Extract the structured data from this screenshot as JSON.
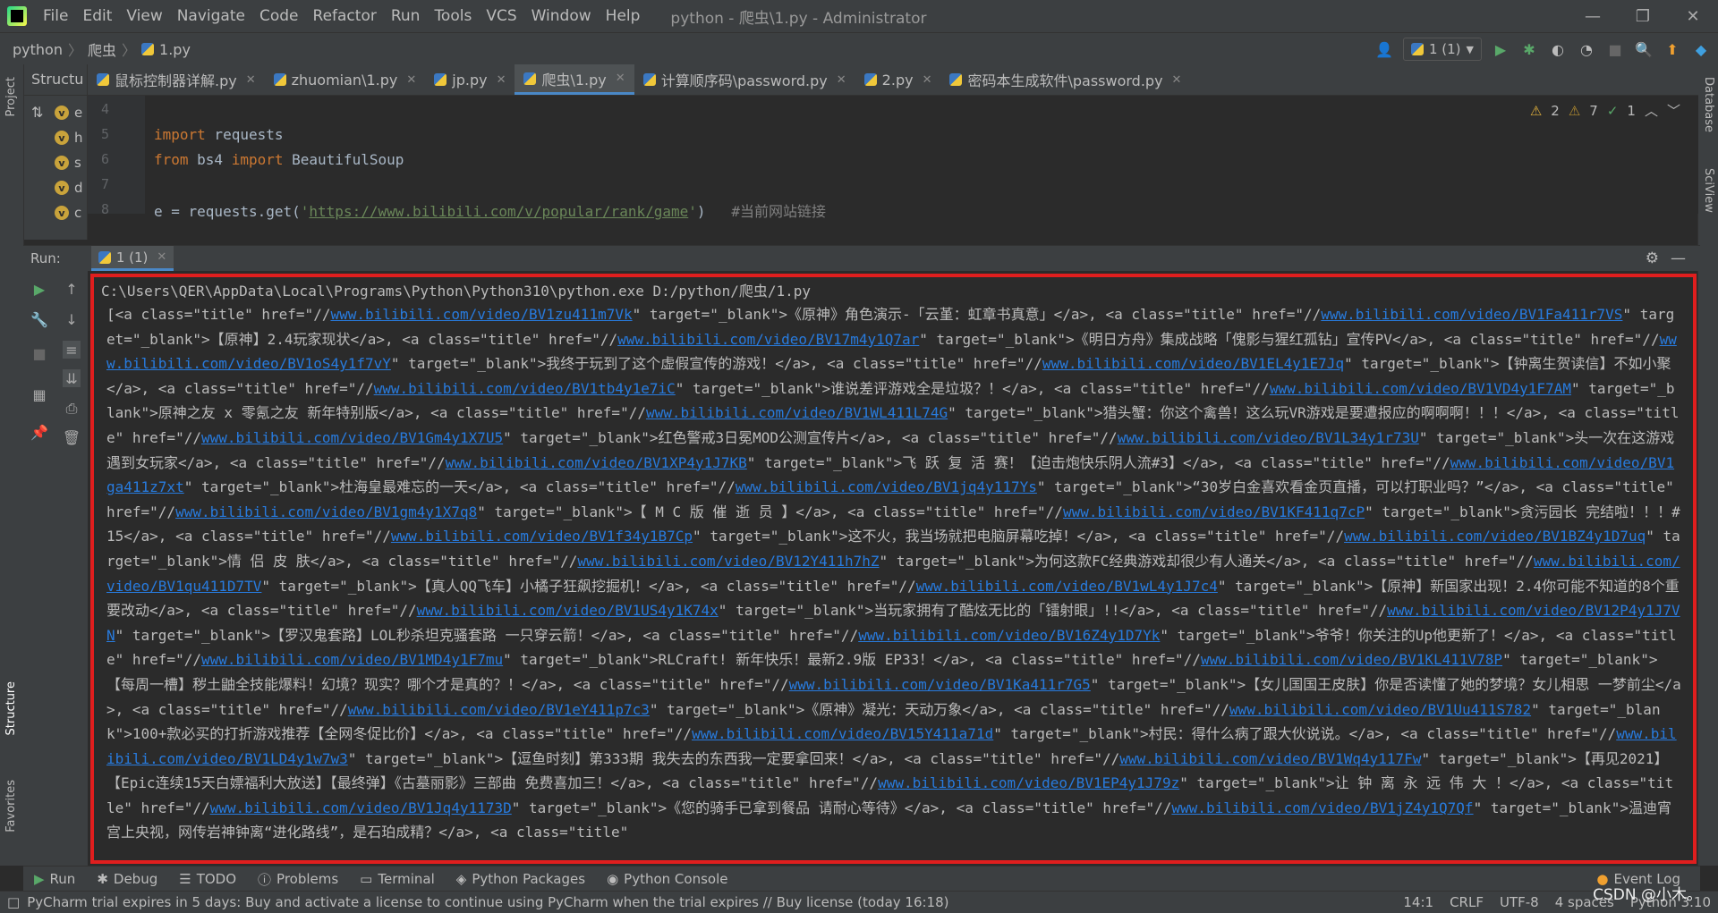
{
  "titlebar": {
    "menu": [
      "File",
      "Edit",
      "View",
      "Navigate",
      "Code",
      "Refactor",
      "Run",
      "Tools",
      "VCS",
      "Window",
      "Help"
    ],
    "title": "python - 爬虫\\1.py - Administrator"
  },
  "navbar": {
    "crumbs": [
      "python",
      "爬虫",
      "1.py"
    ],
    "run_config": "1 (1)"
  },
  "left_stripe": {
    "project": "Project",
    "structure": "Structure",
    "favorites": "Favorites"
  },
  "right_stripe": {
    "database": "Database",
    "sciview": "SciView"
  },
  "structure_panel": {
    "title": "Structu",
    "items": [
      "e",
      "h",
      "s",
      "d",
      "c"
    ]
  },
  "tabs": [
    {
      "label": "鼠标控制器详解.py"
    },
    {
      "label": "zhuomian\\1.py"
    },
    {
      "label": "jp.py"
    },
    {
      "label": "爬虫\\1.py"
    },
    {
      "label": "计算顺序码\\password.py"
    },
    {
      "label": "2.py"
    },
    {
      "label": "密码本生成软件\\password.py"
    }
  ],
  "editor": {
    "lines": [
      "4",
      "5",
      "6",
      "7",
      "8"
    ],
    "code": {
      "l5_kw": "import",
      "l5_rest": " requests",
      "l6_kw1": "from",
      "l6_mod": " bs4 ",
      "l6_kw2": "import",
      "l6_rest": " BeautifulSoup",
      "l8_pre": "e = requests.get(",
      "l8_q1": "'",
      "l8_url": "https://www.bilibili.com/v/popular/rank/game",
      "l8_q2": "'",
      "l8_post": ")   ",
      "l8_cmt": "#当前网站链接"
    },
    "inspections": {
      "warnings": "2",
      "weak": "7",
      "ok": "1"
    }
  },
  "run": {
    "label": "Run:",
    "tab": "1 (1)",
    "command": "C:\\Users\\QER\\AppData\\Local\\Programs\\Python\\Python310\\python.exe D:/python/爬虫/1.py",
    "items": [
      {
        "pre": "[<a class=\"title\" href=\"//",
        "url": "www.bilibili.com/video/BV1zu411m7Vk",
        "post": "\" target=\"_blank\">《原神》角色演示-「云堇：虹章书真意」</a>, "
      },
      {
        "pre": "<a class=\"title\" href=\"//",
        "url": "www.bilibili.com/video/BV1Fa411r7VS",
        "post": "\" target=\"_blank\">【原神】2.4玩家现状</a>, "
      },
      {
        "pre": "<a class=\"title\" href=\"//",
        "url": "www.bilibili.com/video/BV17m4y1Q7ar",
        "post": "\" target=\"_blank\">《明日方舟》集成战略「傀影与猩红孤钻」宣传PV</a>, "
      },
      {
        "pre": "<a class=\"title\" href=\"//",
        "url": "www.bilibili.com/video/BV1oS4y1f7vY",
        "post": "\" target=\"_blank\">我终于玩到了这个虚假宣传的游戏！</a>, "
      },
      {
        "pre": "<a class=\"title\" href=\"//",
        "url": "www.bilibili.com/video/BV1EL4y1E7Jq",
        "post": "\" target=\"_blank\">【钟离生贺读信】不如小聚</a>, "
      },
      {
        "pre": "<a class=\"title\" href=\"//",
        "url": "www.bilibili.com/video/BV1tb4y1e7iC",
        "post": "\" target=\"_blank\">谁说差评游戏全是垃圾？！</a>, "
      },
      {
        "pre": "<a class=\"title\" href=\"//",
        "url": "www.bilibili.com/video/BV1VD4y1F7AM",
        "post": "\" target=\"_blank\">原神之友 x 零氪之友 新年特别版</a>, "
      },
      {
        "pre": "<a class=\"title\" href=\"//",
        "url": "www.bilibili.com/video/BV1WL411L74G",
        "post": "\" target=\"_blank\">猎头蟹：你这个禽兽！这么玩VR游戏是要遭报应的啊啊啊！！！</a>, "
      },
      {
        "pre": "<a class=\"title\" href=\"//",
        "url": "www.bilibili.com/video/BV1Gm4y1X7U5",
        "post": "\" target=\"_blank\">红色警戒3日冕MOD公测宣传片</a>, "
      },
      {
        "pre": "<a class=\"title\" href=\"//",
        "url": "www.bilibili.com/video/BV1L34y1r73U",
        "post": "\" target=\"_blank\">头一次在这游戏遇到女玩家</a>, "
      },
      {
        "pre": "<a class=\"title\" href=\"//",
        "url": "www.bilibili.com/video/BV1XP4y1J7KB",
        "post": "\" target=\"_blank\">飞 跃 复 活 赛！【迫击炮快乐阴人流#3】</a>, "
      },
      {
        "pre": "<a class=\"title\" href=\"//",
        "url": "www.bilibili.com/video/BV1ga411z7xt",
        "post": "\" target=\"_blank\">杜海皇最难忘的一天</a>, "
      },
      {
        "pre": "<a class=\"title\" href=\"//",
        "url": "www.bilibili.com/video/BV1jq4y117Ys",
        "post": "\" target=\"_blank\">“30岁白金喜欢看金页直播，可以打职业吗？”</a>, "
      },
      {
        "pre": "<a class=\"title\" href=\"//",
        "url": "www.bilibili.com/video/BV1gm4y1X7q8",
        "post": "\" target=\"_blank\">【 M C 版 催 逝 员 】</a>, "
      },
      {
        "pre": "<a class=\"title\" href=\"//",
        "url": "www.bilibili.com/video/BV1KF411q7cP",
        "post": "\" target=\"_blank\">贪污园长 完结啦！！！#15</a>, "
      },
      {
        "pre": "<a class=\"title\" href=\"//",
        "url": "www.bilibili.com/video/BV1f34y1B7Cp",
        "post": "\" target=\"_blank\">这不火，我当场就把电脑屏幕吃掉！</a>, "
      },
      {
        "pre": "<a class=\"title\" href=\"//",
        "url": "www.bilibili.com/video/BV1BZ4y1D7uq",
        "post": "\" target=\"_blank\">情 侣 皮 肤</a>, "
      },
      {
        "pre": "<a class=\"title\" href=\"//",
        "url": "www.bilibili.com/video/BV12Y411h7hZ",
        "post": "\" target=\"_blank\">为何这款FC经典游戏却很少有人通关</a>, "
      },
      {
        "pre": "<a class=\"title\" href=\"//",
        "url": "www.bilibili.com/video/BV1qu411D7TV",
        "post": "\" target=\"_blank\">【真人QQ飞车】小橘子狂飙挖掘机！</a>, "
      },
      {
        "pre": "<a class=\"title\" href=\"//",
        "url": "www.bilibili.com/video/BV1wL4y1J7c4",
        "post": "\" target=\"_blank\">【原神】新国家出现！2.4你可能不知道的8个重要改动</a>, "
      },
      {
        "pre": "<a class=\"title\" href=\"//",
        "url": "www.bilibili.com/video/BV1US4y1K74x",
        "post": "\" target=\"_blank\">当玩家拥有了酷炫无比的「镭射眼」!!</a>, "
      },
      {
        "pre": "<a class=\"title\" href=\"//",
        "url": "www.bilibili.com/video/BV12P4y1J7VN",
        "post": "\" target=\"_blank\">【罗汉鬼套路】LOL秒杀坦克骚套路 一只穿云箭！</a>, "
      },
      {
        "pre": "<a class=\"title\" href=\"//",
        "url": "www.bilibili.com/video/BV16Z4y1D7Yk",
        "post": "\" target=\"_blank\">爷爷！你关注的Up他更新了！</a>, "
      },
      {
        "pre": "<a class=\"title\" href=\"//",
        "url": "www.bilibili.com/video/BV1MD4y1F7mu",
        "post": "\" target=\"_blank\">RLCraft! 新年快乐！最新2.9版 EP33！</a>, "
      },
      {
        "pre": "<a class=\"title\" href=\"//",
        "url": "www.bilibili.com/video/BV1KL411V78P",
        "post": "\" target=\"_blank\">【每周一槽】秽土鼬全技能爆料！幻境？现实？哪个才是真的？！</a>, "
      },
      {
        "pre": "<a class=\"title\" href=\"//",
        "url": "www.bilibili.com/video/BV1Ka411r7G5",
        "post": "\" target=\"_blank\">【女儿国国王皮肤】你是否读懂了她的梦境？女儿相思 一梦前尘</a>, "
      },
      {
        "pre": "<a class=\"title\" href=\"//",
        "url": "www.bilibili.com/video/BV1eY411p7c3",
        "post": "\" target=\"_blank\">《原神》凝光：天动万象</a>, "
      },
      {
        "pre": "<a class=\"title\" href=\"//",
        "url": "www.bilibili.com/video/BV1Uu411S782",
        "post": "\" target=\"_blank\">100+款必买的打折游戏推荐【全网冬促比价】</a>, "
      },
      {
        "pre": "<a class=\"title\" href=\"//",
        "url": "www.bilibili.com/video/BV15Y411a71d",
        "post": "\" target=\"_blank\">村民：得什么病了跟大伙说说。</a>, "
      },
      {
        "pre": "<a class=\"title\" href=\"//",
        "url": "www.bilibili.com/video/BV1LD4y1w7w3",
        "post": "\" target=\"_blank\">【逗鱼时刻】第333期 我失去的东西我一定要拿回来！</a>, "
      },
      {
        "pre": "<a class=\"title\" href=\"//",
        "url": "www.bilibili.com/video/BV1Wq4y117Fw",
        "post": "\" target=\"_blank\">【再见2021】【Epic连续15天白嫖福利大放送】【最终弹】《古墓丽影》三部曲 免费喜加三！</a>, "
      },
      {
        "pre": "<a class=\"title\" href=\"//",
        "url": "www.bilibili.com/video/BV1EP4y1J79z",
        "post": "\" target=\"_blank\">让 钟 离 永 远 伟 大 ！</a>, "
      },
      {
        "pre": "<a class=\"title\" href=\"//",
        "url": "www.bilibili.com/video/BV1Jq4y1173D",
        "post": "\" target=\"_blank\">《您的骑手已拿到餐品 请耐心等待》</a>, "
      },
      {
        "pre": "<a class=\"title\" href=\"//",
        "url": "www.bilibili.com/video/BV1jZ4y1Q7Qf",
        "post": "\" target=\"_blank\">温迪宵宫上央视，网传岩神钟离“进化路线”，是石珀成精？</a>, "
      },
      {
        "pre": "<a class=\"title\"",
        "url": "",
        "post": ""
      }
    ]
  },
  "tool_tabs": [
    "Run",
    "Debug",
    "TODO",
    "Problems",
    "Terminal",
    "Python Packages",
    "Python Console"
  ],
  "event_log": "Event Log",
  "status": {
    "message": "PyCharm trial expires in 5 days: Buy and activate a license to continue using PyCharm when the trial expires // Buy license (today 16:18)",
    "position": "14:1",
    "line_sep": "CRLF",
    "encoding": "UTF-8",
    "indent": "4 spaces",
    "interpreter": "Python 3.10"
  },
  "watermark": "CSDN @小木。",
  "colors": {
    "link": "#287bde",
    "highlight_border": "#e01e1e",
    "accent": "#4a88c7"
  }
}
